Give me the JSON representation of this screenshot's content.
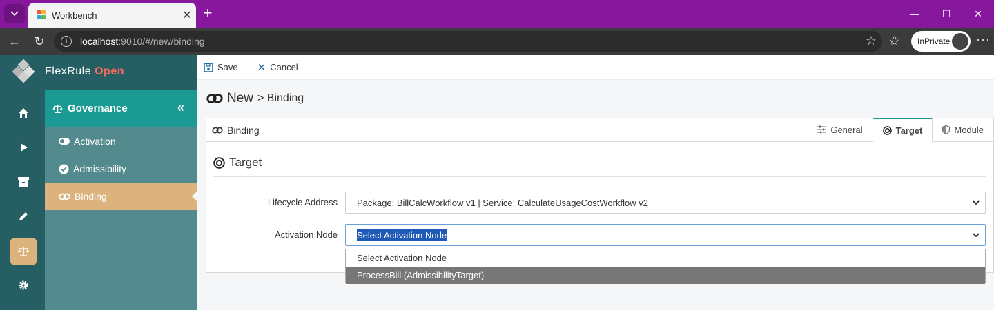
{
  "browser": {
    "tab_title": "Workbench",
    "url_host": "localhost",
    "url_path": ":9010/#/new/binding",
    "inprivate_label": "InPrivate"
  },
  "brand": {
    "name": "FlexRule",
    "suffix": "Open",
    "accent": "#ff6b5a"
  },
  "rail": {
    "items": [
      {
        "icon": "home-icon"
      },
      {
        "icon": "play-icon"
      },
      {
        "icon": "archive-icon"
      },
      {
        "icon": "pencil-icon"
      },
      {
        "icon": "scale-icon",
        "active": true
      },
      {
        "icon": "gear-icon"
      }
    ]
  },
  "subnav": {
    "title": "Governance",
    "items": [
      {
        "label": "Activation",
        "icon": "toggle-icon"
      },
      {
        "label": "Admissibility",
        "icon": "check-circle-icon"
      },
      {
        "label": "Binding",
        "icon": "link-icon",
        "active": true
      }
    ]
  },
  "toolbar": {
    "save_label": "Save",
    "cancel_label": "Cancel"
  },
  "page": {
    "title": "New",
    "crumb": "> Binding"
  },
  "card": {
    "title": "Binding",
    "tabs": [
      {
        "label": "General",
        "icon": "sliders-icon"
      },
      {
        "label": "Target",
        "icon": "target-icon",
        "active": true
      },
      {
        "label": "Module",
        "icon": "shield-icon"
      }
    ]
  },
  "section": {
    "title": "Target"
  },
  "form": {
    "lifecycle_label": "Lifecycle Address",
    "lifecycle_value": "Package: BillCalcWorkflow v1 | Service: CalculateUsageCostWorkflow v2",
    "activation_label": "Activation Node",
    "activation_value": "Select Activation Node",
    "activation_options": [
      "Select Activation Node",
      "ProcessBill (AdmissibilityTarget)"
    ]
  },
  "colors": {
    "browser_frame": "#87179c",
    "rail": "#255e63",
    "subnav_header": "#1a9a92",
    "active_item": "#dcb37d",
    "subnav": "#538a8d"
  }
}
